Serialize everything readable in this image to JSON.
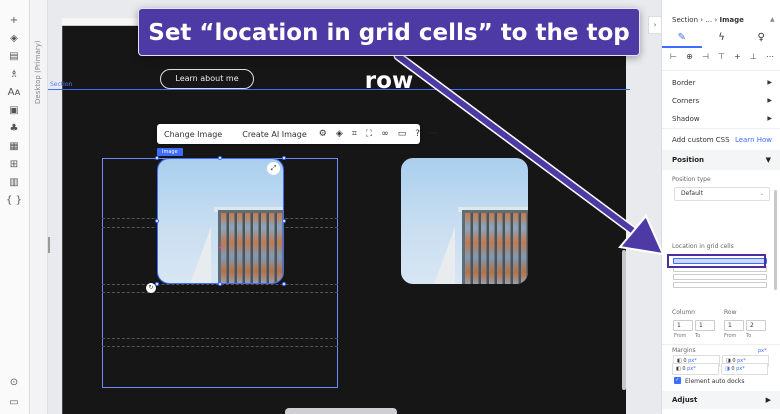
{
  "banner": {
    "text": "Set “location in grid cells” to the top row"
  },
  "canvas": {
    "ruler_label": "Desktop (Primary)",
    "section_label": "Section",
    "learn_button": "Learn about me",
    "image_tag": "Image"
  },
  "float_toolbar": {
    "change_image": "Change Image",
    "create_ai_image": "Create AI Image",
    "help": "?",
    "more": "···"
  },
  "panel": {
    "breadcrumb_prefix": "Section › … ›",
    "breadcrumb_current": "Image",
    "rows": {
      "border": "Border",
      "corners": "Corners",
      "shadow": "Shadow",
      "custom_css": "Add custom CSS",
      "learn_how": "Learn How"
    },
    "position": {
      "header": "Position",
      "type_label": "Position type",
      "type_value": "Default",
      "grid_cells_label": "Location in grid cells",
      "column_label": "Column",
      "row_label": "Row",
      "column_from": "1",
      "column_to": "1",
      "row_from": "1",
      "row_to": "2",
      "from": "From",
      "to": "To"
    },
    "margins": {
      "label": "Margins",
      "unit_label": "px*",
      "top": "0",
      "right": "0",
      "bottom": "0",
      "left": "0",
      "unit": "px*"
    },
    "auto_docks": "Element auto docks",
    "adjust": "Adjust"
  },
  "colors": {
    "accent": "#3e6dff",
    "banner": "#4d3aa5",
    "canvas": "#161616"
  }
}
